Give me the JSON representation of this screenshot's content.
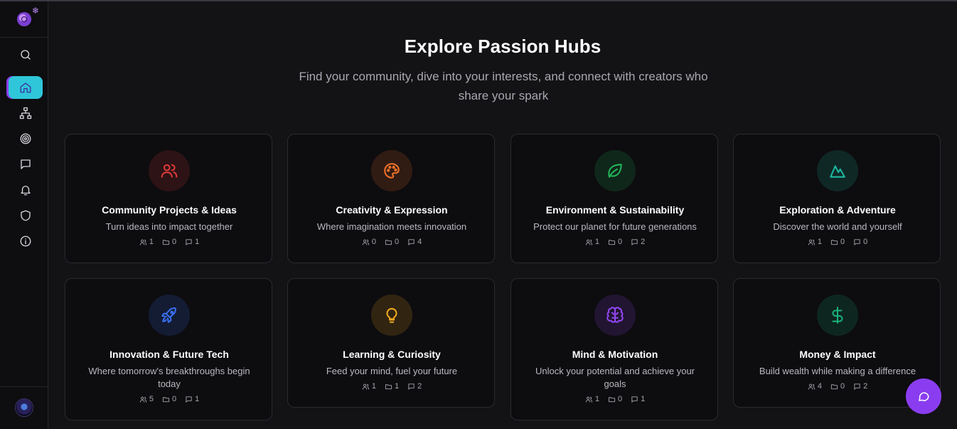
{
  "header": {
    "title": "Explore Passion Hubs",
    "subtitle": "Find your community, dive into your interests, and connect with creators who share your spark"
  },
  "colors": {
    "active_nav": "#2fc6d9",
    "accent": "#8a3df0"
  },
  "sidebar": {
    "items": [
      {
        "icon": "search-icon",
        "label": ""
      },
      {
        "icon": "home-icon",
        "label": "",
        "active": true
      },
      {
        "icon": "sitemap-icon",
        "label": ""
      },
      {
        "icon": "target-icon",
        "label": ""
      },
      {
        "icon": "message-icon",
        "label": ""
      },
      {
        "icon": "bell-icon",
        "label": ""
      },
      {
        "icon": "shield-icon",
        "label": ""
      },
      {
        "icon": "info-icon",
        "label": ""
      }
    ]
  },
  "hubs": [
    {
      "title": "Community Projects & Ideas",
      "description": "Turn ideas into impact together",
      "members": "1",
      "projects": "0",
      "posts": "1",
      "icon": "users-icon",
      "color": "#dc3a3a"
    },
    {
      "title": "Creativity & Expression",
      "description": "Where imagination meets innovation",
      "members": "0",
      "projects": "0",
      "posts": "4",
      "icon": "palette-icon",
      "color": "#f0722a"
    },
    {
      "title": "Environment & Sustainability",
      "description": "Protect our planet for future generations",
      "members": "1",
      "projects": "0",
      "posts": "2",
      "icon": "leaf-icon",
      "color": "#22b35a"
    },
    {
      "title": "Exploration & Adventure",
      "description": "Discover the world and yourself",
      "members": "1",
      "projects": "0",
      "posts": "0",
      "icon": "mountain-icon",
      "color": "#1db8a0"
    },
    {
      "title": "Innovation & Future Tech",
      "description": "Where tomorrow's breakthroughs begin today",
      "members": "5",
      "projects": "0",
      "posts": "1",
      "icon": "rocket-icon",
      "color": "#3b6ff0"
    },
    {
      "title": "Learning & Curiosity",
      "description": "Feed your mind, fuel your future",
      "members": "1",
      "projects": "1",
      "posts": "2",
      "icon": "lightbulb-icon",
      "color": "#f0a81f"
    },
    {
      "title": "Mind & Motivation",
      "description": "Unlock your potential and achieve your goals",
      "members": "1",
      "projects": "0",
      "posts": "1",
      "icon": "brain-icon",
      "color": "#9146ef"
    },
    {
      "title": "Money & Impact",
      "description": "Build wealth while making a difference",
      "members": "4",
      "projects": "0",
      "posts": "2",
      "icon": "dollar-icon",
      "color": "#19b07a"
    }
  ],
  "chat_button": {
    "icon": "chat-icon"
  }
}
